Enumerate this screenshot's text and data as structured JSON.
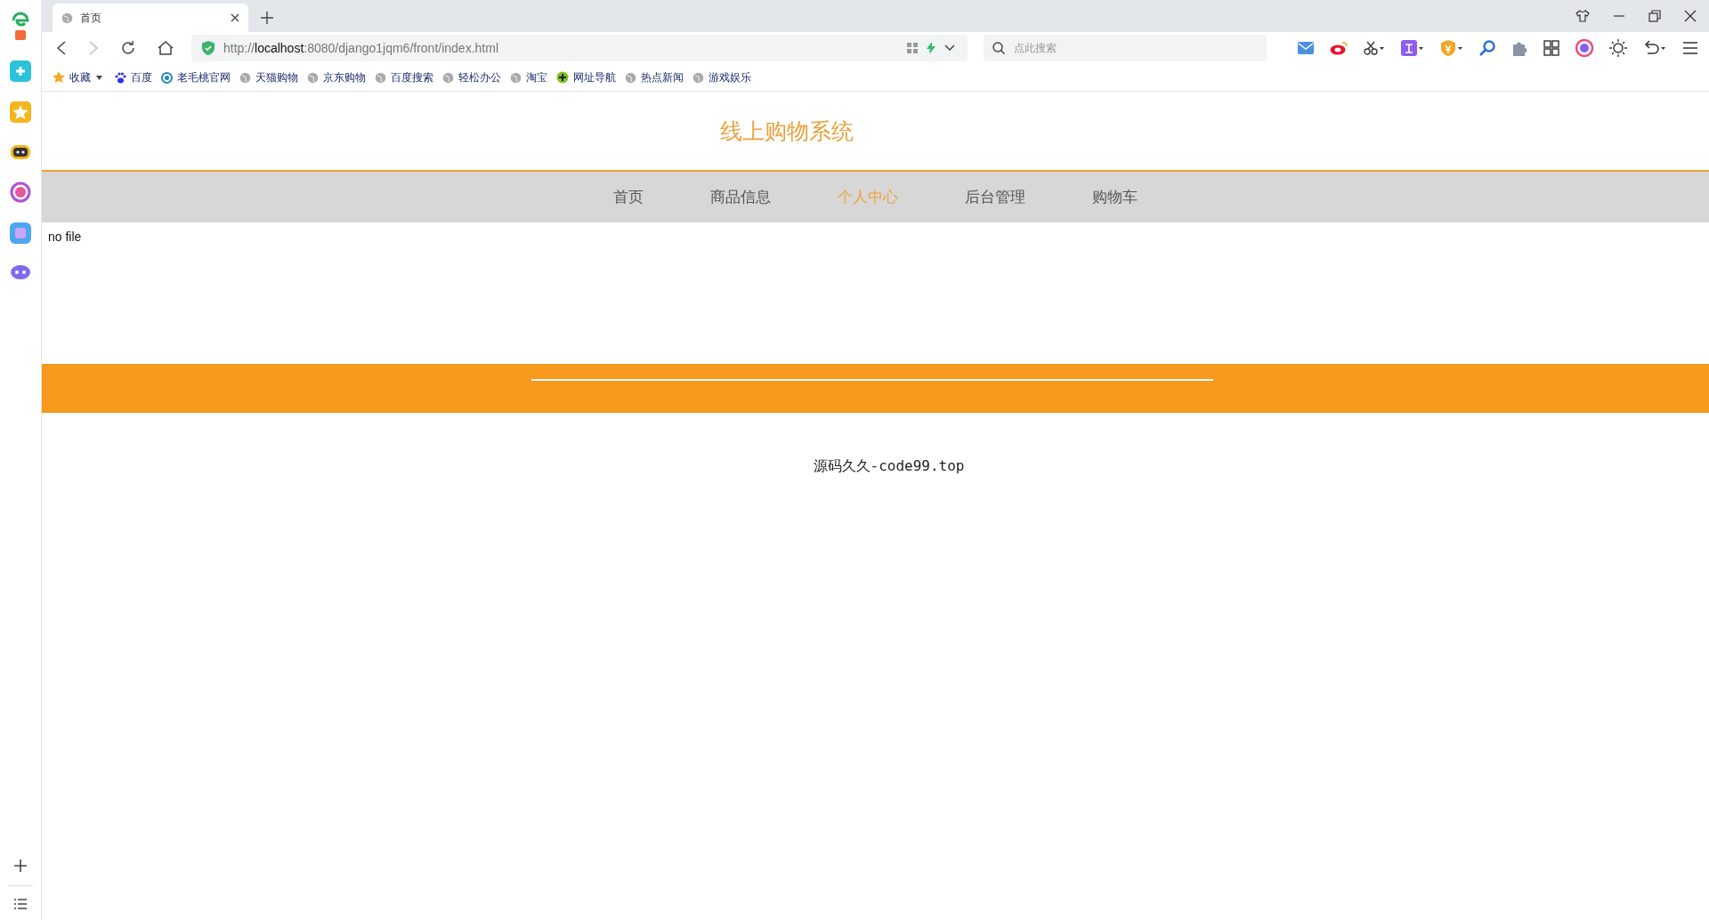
{
  "browser": {
    "tab": {
      "title": "首页",
      "selected": true
    },
    "address": {
      "url": "http://**localhost**:8080/django1jqm6/front/index.html"
    },
    "search": {
      "placeholder": "点此搜索"
    },
    "bookmarks": [
      {
        "label": "收藏",
        "kind": "star"
      },
      {
        "label": "百度",
        "kind": "paw"
      },
      {
        "label": "老毛桃官网",
        "kind": "ring"
      },
      {
        "label": "天猫购物",
        "kind": "globe"
      },
      {
        "label": "京东购物",
        "kind": "globe"
      },
      {
        "label": "百度搜索",
        "kind": "globe"
      },
      {
        "label": "轻松办公",
        "kind": "globe"
      },
      {
        "label": "淘宝",
        "kind": "globe"
      },
      {
        "label": "网址导航",
        "kind": "plus"
      },
      {
        "label": "热点新闻",
        "kind": "globe"
      },
      {
        "label": "游戏娱乐",
        "kind": "globe"
      }
    ]
  },
  "page": {
    "site_title": "线上购物系统",
    "nav": [
      {
        "label": "首页",
        "selected": false
      },
      {
        "label": "商品信息",
        "selected": false
      },
      {
        "label": "个人中心",
        "selected": true
      },
      {
        "label": "后台管理",
        "selected": false
      },
      {
        "label": "购物车",
        "selected": false
      }
    ],
    "message": "no file",
    "footer": "源码久久-code99.top"
  }
}
